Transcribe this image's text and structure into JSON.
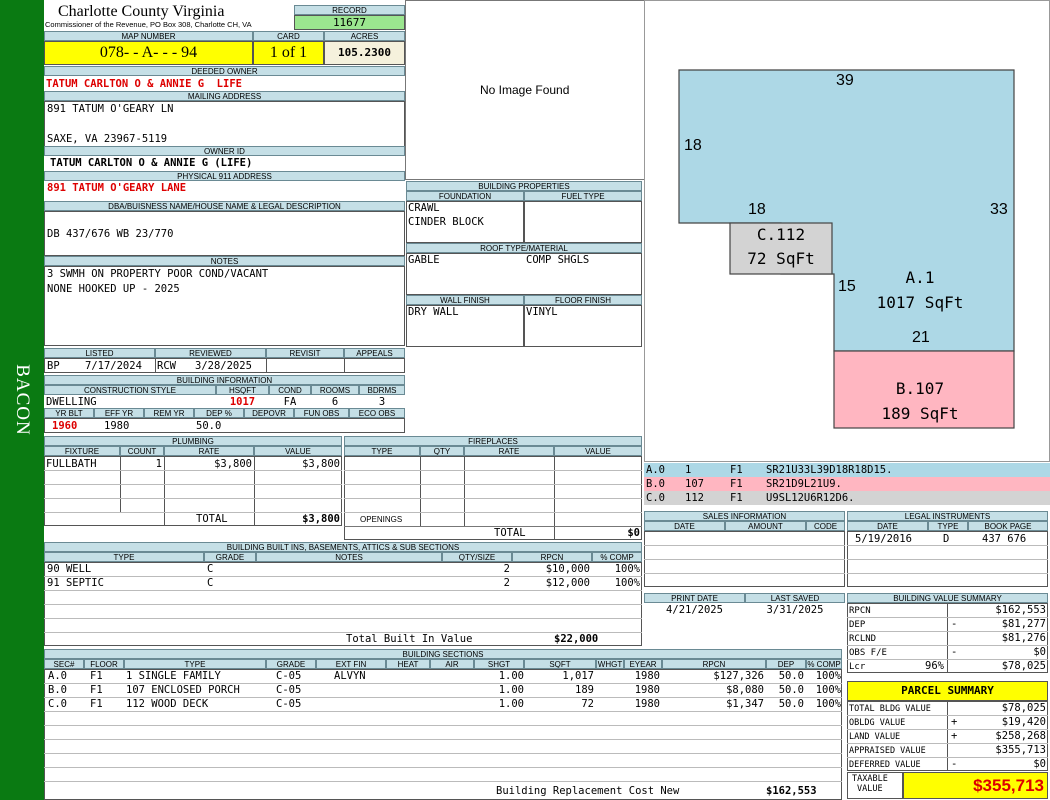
{
  "sidebar": {
    "district": "BACON"
  },
  "header": {
    "county": "Charlotte County Virginia",
    "address": "Commissioner of the Revenue, PO Box 308, Charlotte CH, VA",
    "record_label": "RECORD",
    "record": "11677",
    "map_label": "MAP NUMBER",
    "map": "078- - A- - - 94",
    "card_label": "CARD",
    "card": "1 of 1",
    "acres_label": "ACRES",
    "acres": "105.2300"
  },
  "owner": {
    "deeded_label": "DEEDED OWNER",
    "deeded": "TATUM CARLTON O & ANNIE G  LIFE",
    "mailing_label": "MAILING ADDRESS",
    "mailing1": "891 TATUM O'GEARY LN",
    "mailing2": "SAXE, VA 23967-5119",
    "ownerid_label": "OWNER ID",
    "ownerid": "TATUM CARLTON O & ANNIE G (LIFE)",
    "physical_label": "PHYSICAL 911 ADDRESS",
    "physical": "891 TATUM O'GEARY LANE",
    "dba_label": "DBA/BUISNESS NAME/HOUSE NAME & LEGAL DESCRIPTION",
    "dba": "DB 437/676 WB 23/770",
    "notes_label": "NOTES",
    "notes1": "3 SWMH ON PROPERTY POOR COND/VACANT",
    "notes2": "NONE HOOKED UP - 2025"
  },
  "photo": {
    "text": "No Image Found"
  },
  "building_props": {
    "title": "BUILDING PROPERTIES",
    "foundation_label": "FOUNDATION",
    "fuel_label": "FUEL TYPE",
    "foundation1": "CRAWL",
    "foundation2": "CINDER BLOCK",
    "roof_label": "ROOF TYPE/MATERIAL",
    "roof_type": "GABLE",
    "roof_mat": "COMP SHGLS",
    "wall_label": "WALL FINISH",
    "floor_label": "FLOOR FINISH",
    "wall": "DRY WALL",
    "floor": "VINYL"
  },
  "status": {
    "listed_label": "LISTED",
    "reviewed_label": "REVIEWED",
    "revisit_label": "REVISIT",
    "appeals_label": "APPEALS",
    "listed_by": "BP",
    "listed_date": "7/17/2024",
    "reviewed_by": "RCW",
    "reviewed_date": "3/28/2025"
  },
  "building_info": {
    "title": "BUILDING INFORMATION",
    "style_label": "CONSTRUCTION STYLE",
    "hsqft_label": "HSQFT",
    "cond_label": "COND",
    "rooms_label": "ROOMS",
    "bdrms_label": "BDRMS",
    "style": "DWELLING",
    "hsqft": "1017",
    "cond": "FA",
    "rooms": "6",
    "bdrms": "3",
    "yrblt_label": "YR BLT",
    "effyr_label": "EFF YR",
    "remyr_label": "REM YR",
    "dep_label": "DEP %",
    "depovr_label": "DEPOVR",
    "funobs_label": "FUN OBS",
    "ecoobs_label": "ECO OBS",
    "yrblt": "1960",
    "effyr": "1980",
    "dep": "50.0"
  },
  "plumbing": {
    "title": "PLUMBING",
    "cols": [
      "FIXTURE",
      "COUNT",
      "RATE",
      "VALUE"
    ],
    "rows": [
      {
        "fixture": "FULLBATH",
        "count": "1",
        "rate": "$3,800",
        "value": "$3,800"
      }
    ],
    "total_label": "TOTAL",
    "total": "$3,800"
  },
  "fireplaces": {
    "title": "FIREPLACES",
    "cols": [
      "TYPE",
      "QTY",
      "RATE",
      "VALUE"
    ],
    "openings_label": "OPENINGS",
    "total_label": "TOTAL",
    "total": "$0"
  },
  "sketch": {
    "dims": {
      "top": "39",
      "left": "18",
      "right": "33",
      "inner": "18",
      "mid": "15",
      "bottom": "21"
    },
    "a_label": "A.1",
    "a_area": "1017 SqFt",
    "b_label": "B.107",
    "b_area": "189 SqFt",
    "c_label": "C.112",
    "c_area": "72 SqFt"
  },
  "sketch_legend": [
    {
      "sec": "A.0",
      "code": "1",
      "fl": "F1",
      "path": "SR21U33L39D18R18D15."
    },
    {
      "sec": "B.0",
      "code": "107",
      "fl": "F1",
      "path": "SR21D9L21U9."
    },
    {
      "sec": "C.0",
      "code": "112",
      "fl": "F1",
      "path": "U9SL12U6R12D6."
    }
  ],
  "builtins": {
    "title": "BUILDING BUILT INS, BASEMENTS, ATTICS & SUB SECTIONS",
    "cols": [
      "TYPE",
      "GRADE",
      "NOTES",
      "QTY/SIZE",
      "RPCN",
      "% COMP"
    ],
    "rows": [
      {
        "type": "90 WELL",
        "grade": "C",
        "qty": "2",
        "rpcn": "$10,000",
        "comp": "100%"
      },
      {
        "type": "91 SEPTIC",
        "grade": "C",
        "qty": "2",
        "rpcn": "$12,000",
        "comp": "100%"
      }
    ],
    "total_label": "Total Built In Value",
    "total": "$22,000"
  },
  "sales": {
    "title": "SALES INFORMATION",
    "cols": [
      "DATE",
      "AMOUNT",
      "CODE"
    ]
  },
  "legal": {
    "title": "LEGAL INSTRUMENTS",
    "cols": [
      "DATE",
      "TYPE",
      "BOOK PAGE"
    ],
    "rows": [
      {
        "date": "5/19/2016",
        "type": "D",
        "book": "437 676"
      }
    ]
  },
  "dates": {
    "print_label": "PRINT DATE",
    "saved_label": "LAST SAVED",
    "print": "4/21/2025",
    "saved": "3/31/2025"
  },
  "value_summary": {
    "title": "BUILDING VALUE SUMMARY",
    "rpcn_label": "RPCN",
    "rpcn": "$162,553",
    "dep_label": "DEP",
    "dep_sign": "-",
    "dep": "$81,277",
    "rclnd_label": "RCLND",
    "rclnd": "$81,276",
    "obs_label": "OBS F/E",
    "obs_sign": "-",
    "obs": "$0",
    "lcr_label": "Lcr",
    "lcr_pct": "96%",
    "lcr": "$78,025"
  },
  "parcel": {
    "title": "PARCEL SUMMARY",
    "bldg_label": "TOTAL BLDG VALUE",
    "bldg": "$78,025",
    "obldg_label": "OBLDG VALUE",
    "obldg_sign": "+",
    "obldg": "$19,420",
    "land_label": "LAND VALUE",
    "land_sign": "+",
    "land": "$258,268",
    "appraised_label": "APPRAISED VALUE",
    "appraised": "$355,713",
    "deferred_label": "DEFERRED VALUE",
    "deferred_sign": "-",
    "deferred": "$0",
    "taxable_label1": "TAXABLE",
    "taxable_label2": "VALUE",
    "taxable": "$355,713"
  },
  "sections": {
    "title": "BUILDING SECTIONS",
    "cols": [
      "SEC#",
      "FLOOR",
      "TYPE",
      "GRADE",
      "EXT FIN",
      "HEAT",
      "AIR",
      "SHGT",
      "SQFT",
      "WHGT",
      "EYEAR",
      "RPCN",
      "DEP",
      "% COMP"
    ],
    "rows": [
      {
        "sec": "A.0",
        "floor": "F1",
        "type": "1 SINGLE FAMILY",
        "grade": "C-05",
        "ext": "ALVYN",
        "shgt": "1.00",
        "sqft": "1,017",
        "eyear": "1980",
        "rpcn": "$127,326",
        "dep": "50.0",
        "comp": "100%"
      },
      {
        "sec": "B.0",
        "floor": "F1",
        "type": "107 ENCLOSED PORCH",
        "grade": "C-05",
        "ext": "",
        "shgt": "1.00",
        "sqft": "189",
        "eyear": "1980",
        "rpcn": "$8,080",
        "dep": "50.0",
        "comp": "100%"
      },
      {
        "sec": "C.0",
        "floor": "F1",
        "type": "112 WOOD DECK",
        "grade": "C-05",
        "ext": "",
        "shgt": "1.00",
        "sqft": "72",
        "eyear": "1980",
        "rpcn": "$1,347",
        "dep": "50.0",
        "comp": "100%"
      }
    ],
    "total_label": "Building Replacement Cost New",
    "total": "$162,553"
  }
}
